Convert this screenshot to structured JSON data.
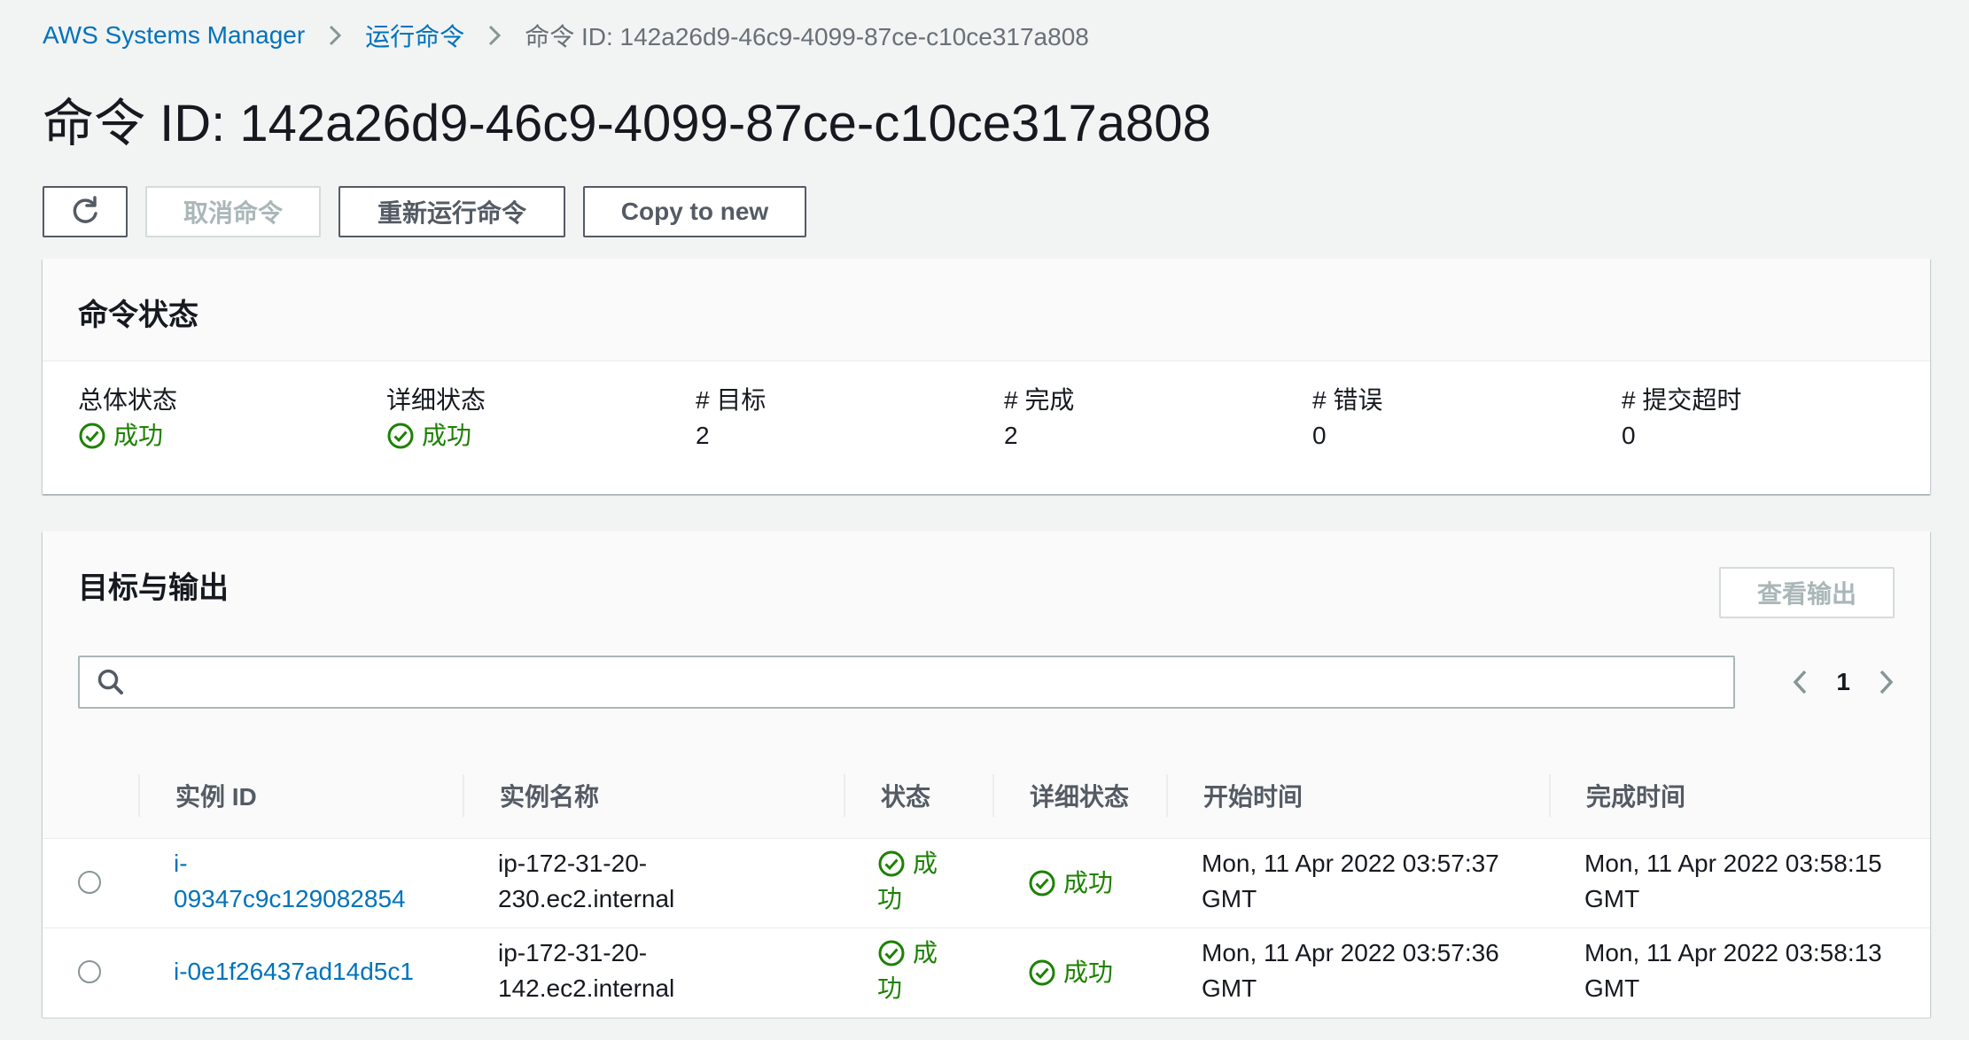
{
  "breadcrumb": {
    "items": [
      "AWS Systems Manager",
      "运行命令",
      "命令 ID: 142a26d9-46c9-4099-87ce-c10ce317a808"
    ]
  },
  "page": {
    "title": "命令 ID: 142a26d9-46c9-4099-87ce-c10ce317a808"
  },
  "actions": {
    "refresh_icon": "refresh-icon",
    "cancel_label": "取消命令",
    "rerun_label": "重新运行命令",
    "copy_label": "Copy to new"
  },
  "command_status": {
    "title": "命令状态",
    "fields": [
      {
        "label": "总体状态",
        "value": "成功",
        "success": true
      },
      {
        "label": "详细状态",
        "value": "成功",
        "success": true
      },
      {
        "label": "# 目标",
        "value": "2"
      },
      {
        "label": "# 完成",
        "value": "2"
      },
      {
        "label": "# 错误",
        "value": "0"
      },
      {
        "label": "# 提交超时",
        "value": "0"
      }
    ]
  },
  "targets": {
    "title": "目标与输出",
    "view_output_label": "查看输出",
    "search": {
      "placeholder": "",
      "value": ""
    },
    "pagination": {
      "current_page": "1"
    },
    "columns": [
      "实例 ID",
      "实例名称",
      "状态",
      "详细状态",
      "开始时间",
      "完成时间"
    ],
    "rows": [
      {
        "instance_id_line1": "i-",
        "instance_id_line2": "09347c9c129082854",
        "instance_name_line1": "ip-172-31-20-",
        "instance_name_line2": "230.ec2.internal",
        "status_line1": "成",
        "status_line2": "功",
        "detail_status": "成功",
        "start_line1": "Mon, 11 Apr 2022 03:57:37",
        "start_line2": "GMT",
        "end_line1": "Mon, 11 Apr 2022 03:58:15",
        "end_line2": "GMT"
      },
      {
        "instance_id_line1": "i-0e1f26437ad14d5c1",
        "instance_id_line2": "",
        "instance_name_line1": "ip-172-31-20-",
        "instance_name_line2": "142.ec2.internal",
        "status_line1": "成",
        "status_line2": "功",
        "detail_status": "成功",
        "start_line1": "Mon, 11 Apr 2022 03:57:36",
        "start_line2": "GMT",
        "end_line1": "Mon, 11 Apr 2022 03:58:13",
        "end_line2": "GMT"
      }
    ]
  },
  "colors": {
    "link": "#0073bb",
    "success": "#1d8102",
    "muted": "#687078",
    "disabled": "#aab7b8"
  }
}
